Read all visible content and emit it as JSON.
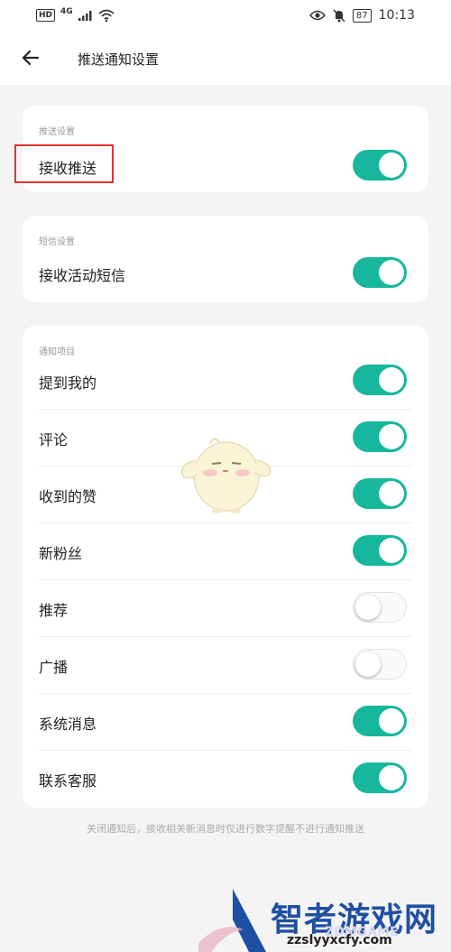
{
  "status_bar": {
    "hd": "HD",
    "network": "4G",
    "battery": "87",
    "time": "10:13"
  },
  "header": {
    "title": "推送通知设置"
  },
  "push_section": {
    "label": "推送设置",
    "items": [
      {
        "label": "接收推送",
        "enabled": true
      }
    ]
  },
  "sms_section": {
    "label": "短信设置",
    "items": [
      {
        "label": "接收活动短信",
        "enabled": true
      }
    ]
  },
  "notify_section": {
    "label": "通知项目",
    "items": [
      {
        "label": "提到我的",
        "enabled": true
      },
      {
        "label": "评论",
        "enabled": true
      },
      {
        "label": "收到的赞",
        "enabled": true
      },
      {
        "label": "新粉丝",
        "enabled": true
      },
      {
        "label": "推荐",
        "enabled": false
      },
      {
        "label": "广播",
        "enabled": false
      },
      {
        "label": "系统消息",
        "enabled": true
      },
      {
        "label": "联系客服",
        "enabled": true
      }
    ]
  },
  "footnote": "关闭通知后，接收相关新消息时仅进行数字提醒不进行通知推送",
  "watermark": {
    "name": "智者游戏网",
    "url": "zzslyyxcfy.com",
    "en": "ZDMGAME"
  },
  "colors": {
    "toggle_on": "#16b79d",
    "highlight": "#e03232"
  }
}
